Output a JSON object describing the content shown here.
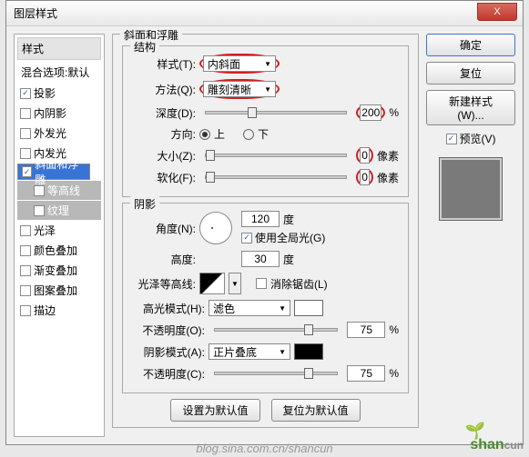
{
  "window_title": "图层样式",
  "close_x": "X",
  "left": {
    "header": "样式",
    "blend": "混合选项:默认",
    "items": [
      {
        "label": "投影",
        "checked": true
      },
      {
        "label": "内阴影",
        "checked": false
      },
      {
        "label": "外发光",
        "checked": false
      },
      {
        "label": "内发光",
        "checked": false
      },
      {
        "label": "斜面和浮雕",
        "checked": true,
        "selected": true
      },
      {
        "label": "等高线",
        "checked": false,
        "sub": true
      },
      {
        "label": "纹理",
        "checked": false,
        "sub": true
      },
      {
        "label": "光泽",
        "checked": false
      },
      {
        "label": "颜色叠加",
        "checked": false
      },
      {
        "label": "渐变叠加",
        "checked": false
      },
      {
        "label": "图案叠加",
        "checked": false
      },
      {
        "label": "描边",
        "checked": false
      }
    ]
  },
  "bevel": {
    "section": "斜面和浮雕",
    "structure": "结构",
    "style_lbl": "样式(T):",
    "style_val": "内斜面",
    "tech_lbl": "方法(Q):",
    "tech_val": "雕刻清晰",
    "depth_lbl": "深度(D):",
    "depth_val": "200",
    "pct": "%",
    "dir_lbl": "方向:",
    "up": "上",
    "down": "下",
    "size_lbl": "大小(Z):",
    "size_val": "0",
    "px": "像素",
    "soft_lbl": "软化(F):",
    "soft_val": "0",
    "shading": "阴影",
    "angle_lbl": "角度(N):",
    "angle_val": "120",
    "deg": "度",
    "global": "使用全局光(G)",
    "alt_lbl": "高度:",
    "alt_val": "30",
    "gloss_lbl": "光泽等高线:",
    "anti": "消除锯齿(L)",
    "hmode_lbl": "高光模式(H):",
    "hmode_val": "滤色",
    "hopac_lbl": "不透明度(O):",
    "hopac_val": "75",
    "smode_lbl": "阴影模式(A):",
    "smode_val": "正片叠底",
    "sopac_lbl": "不透明度(C):",
    "sopac_val": "75",
    "make_default": "设置为默认值",
    "reset_default": "复位为默认值"
  },
  "right": {
    "ok": "确定",
    "cancel": "复位",
    "new_style": "新建样式(W)...",
    "preview": "预览(V)"
  },
  "watermark": "blog.sina.com.cn/shancun",
  "wmlogo": "shancun"
}
